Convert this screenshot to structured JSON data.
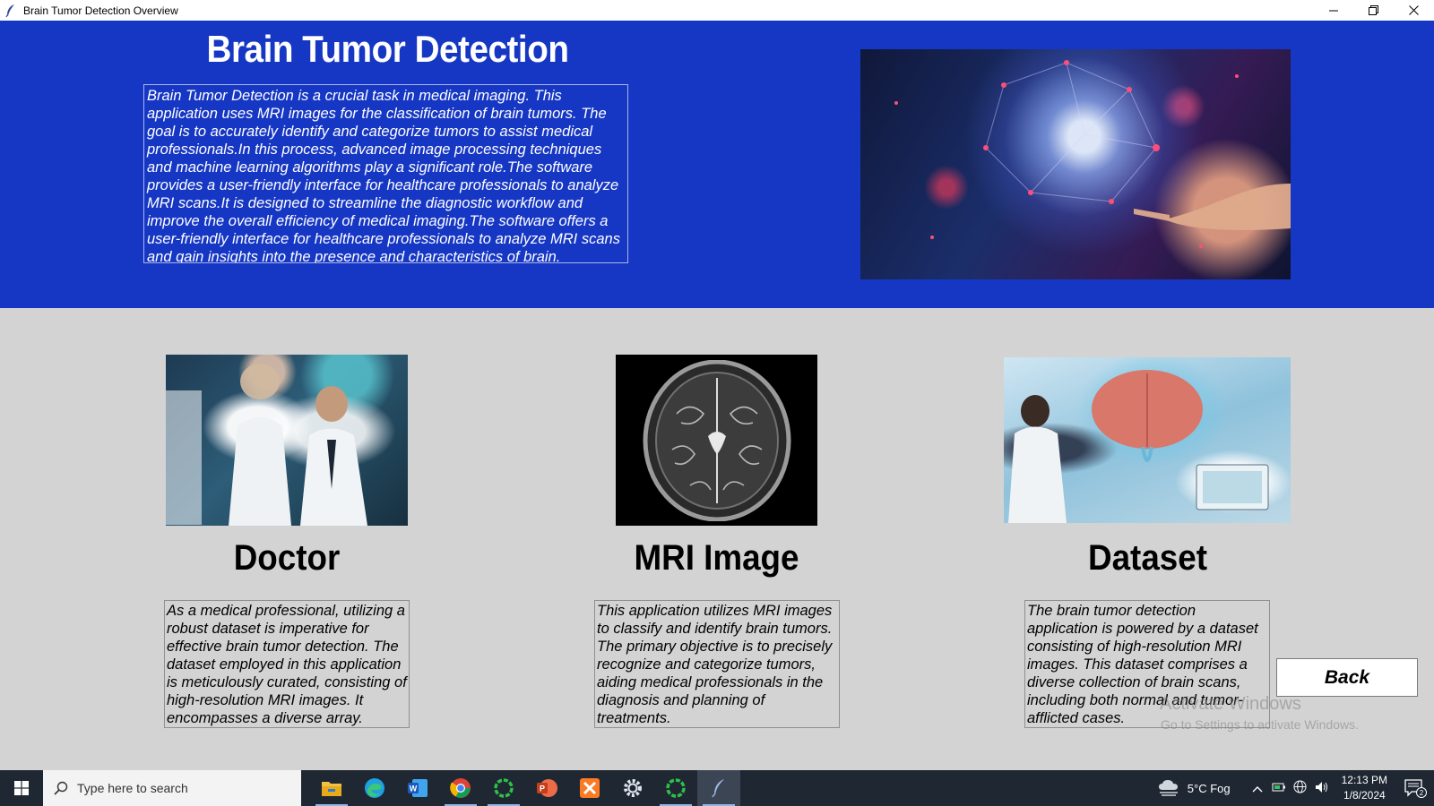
{
  "window": {
    "title": "Brain Tumor Detection Overview",
    "controls": [
      "minimize-icon",
      "restore-icon",
      "close-icon"
    ]
  },
  "header": {
    "title": "Brain Tumor Detection",
    "intro": "Brain Tumor Detection is a crucial task in medical imaging. This application uses MRI images for the classification of brain tumors. The goal is to accurately identify and categorize tumors to assist medical professionals.In this process, advanced image processing techniques and machine learning algorithms play a significant role.The software provides a user-friendly interface for healthcare professionals to analyze MRI scans.It is designed to streamline the diagnostic workflow and improve the overall efficiency of medical imaging.The software offers a user-friendly interface for healthcare professionals to analyze MRI scans and gain insights into the presence and characteristics of brain."
  },
  "cards": [
    {
      "title": "Doctor",
      "description": "As a medical professional, utilizing a robust dataset is imperative for effective brain tumor detection. The dataset employed in this application is meticulously curated, consisting of high-resolution MRI images. It encompasses a diverse array."
    },
    {
      "title": "MRI Image",
      "description": "This application utilizes MRI images to classify and identify brain tumors. The primary objective is to precisely recognize and categorize tumors, aiding medical professionals in the diagnosis and planning of treatments."
    },
    {
      "title": "Dataset",
      "description": "The brain tumor detection application is powered by a dataset consisting of high-resolution MRI images. This dataset comprises a diverse collection of brain scans, including both normal and tumor-afflicted cases."
    }
  ],
  "back_button": "Back",
  "watermark": {
    "line1": "Activate Windows",
    "line2": "Go to Settings to activate Windows."
  },
  "taskbar": {
    "search_placeholder": "Type here to search",
    "apps": [
      "file-explorer-icon",
      "edge-icon",
      "word-icon",
      "chrome-icon",
      "loader-app-icon",
      "powerpoint-icon",
      "xampp-icon",
      "settings-icon",
      "loader-app-icon",
      "python-tk-icon"
    ],
    "weather": "5°C  Fog",
    "time": "12:13 PM",
    "date": "1/8/2024",
    "notifications": "2"
  },
  "colors": {
    "header_bg": "#1637c4",
    "body_bg": "#d3d3d3",
    "taskbar_bg": "#1f2733"
  }
}
